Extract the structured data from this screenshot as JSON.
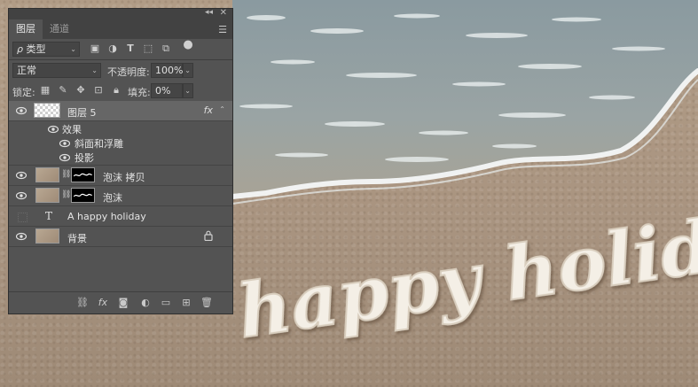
{
  "panel": {
    "tabs": [
      {
        "label": "图层",
        "active": true
      },
      {
        "label": "通道",
        "active": false
      }
    ],
    "filter_row": {
      "search_glyph": "ρ",
      "kind_value": "类型"
    },
    "blend_row": {
      "blend_mode_value": "正常",
      "opacity_label": "不透明度:",
      "opacity_value": "100%"
    },
    "lock_row": {
      "lock_label": "锁定:",
      "fill_label": "填充:",
      "fill_value": "0%"
    },
    "layers": [
      {
        "name": "图层 5",
        "thumb": "checker",
        "selected": true,
        "visible": true,
        "has_fx": true
      },
      {
        "name": "泡沫 拷贝",
        "thumb": "sand",
        "mask": true,
        "visible": true
      },
      {
        "name": "泡沫",
        "thumb": "sand",
        "mask": true,
        "visible": true
      },
      {
        "name": "A happy holiday",
        "type_layer": true,
        "visible": false
      },
      {
        "name": "背景",
        "thumb": "sand",
        "locked": true,
        "visible": true
      }
    ],
    "effects": {
      "label": "效果",
      "items": [
        "斜面和浮雕",
        "投影"
      ]
    },
    "fx_symbol": "fx",
    "type_glyph": "T"
  },
  "canvas_text": "happy holiday"
}
